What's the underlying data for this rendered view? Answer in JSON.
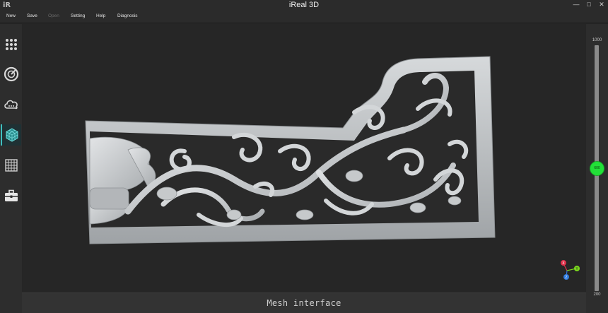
{
  "window": {
    "logo": "iR",
    "title": "iReal 3D",
    "controls": {
      "minimize": "—",
      "maximize": "□",
      "close": "✕"
    }
  },
  "menu": [
    {
      "label": "New",
      "enabled": true
    },
    {
      "label": "Save",
      "enabled": true
    },
    {
      "label": "Open",
      "enabled": false
    },
    {
      "label": "Setting",
      "enabled": true
    },
    {
      "label": "Help",
      "enabled": true
    },
    {
      "label": "Diagnosis",
      "enabled": true
    }
  ],
  "toolbar": {
    "tools": [
      {
        "icon": "point-grid-icon",
        "active": false
      },
      {
        "icon": "scan-dial-icon",
        "active": false
      },
      {
        "icon": "point-cloud-icon",
        "active": false
      },
      {
        "icon": "mesh-cube-icon",
        "active": true
      },
      {
        "icon": "grid-table-icon",
        "active": false
      },
      {
        "icon": "toolbox-icon",
        "active": false
      }
    ]
  },
  "status": {
    "text": "Mesh interface"
  },
  "slider": {
    "max": "1000",
    "min": "200",
    "value": "600"
  },
  "axis_gizmo": {
    "x": "X",
    "y": "Y",
    "z": "Z"
  },
  "colors": {
    "accent": "#3fbfbf",
    "slider_knob": "#22e038",
    "axis_x": "#e0304a",
    "axis_y": "#7ad61e",
    "axis_z": "#2f7be0",
    "model": "#c9ccce"
  }
}
